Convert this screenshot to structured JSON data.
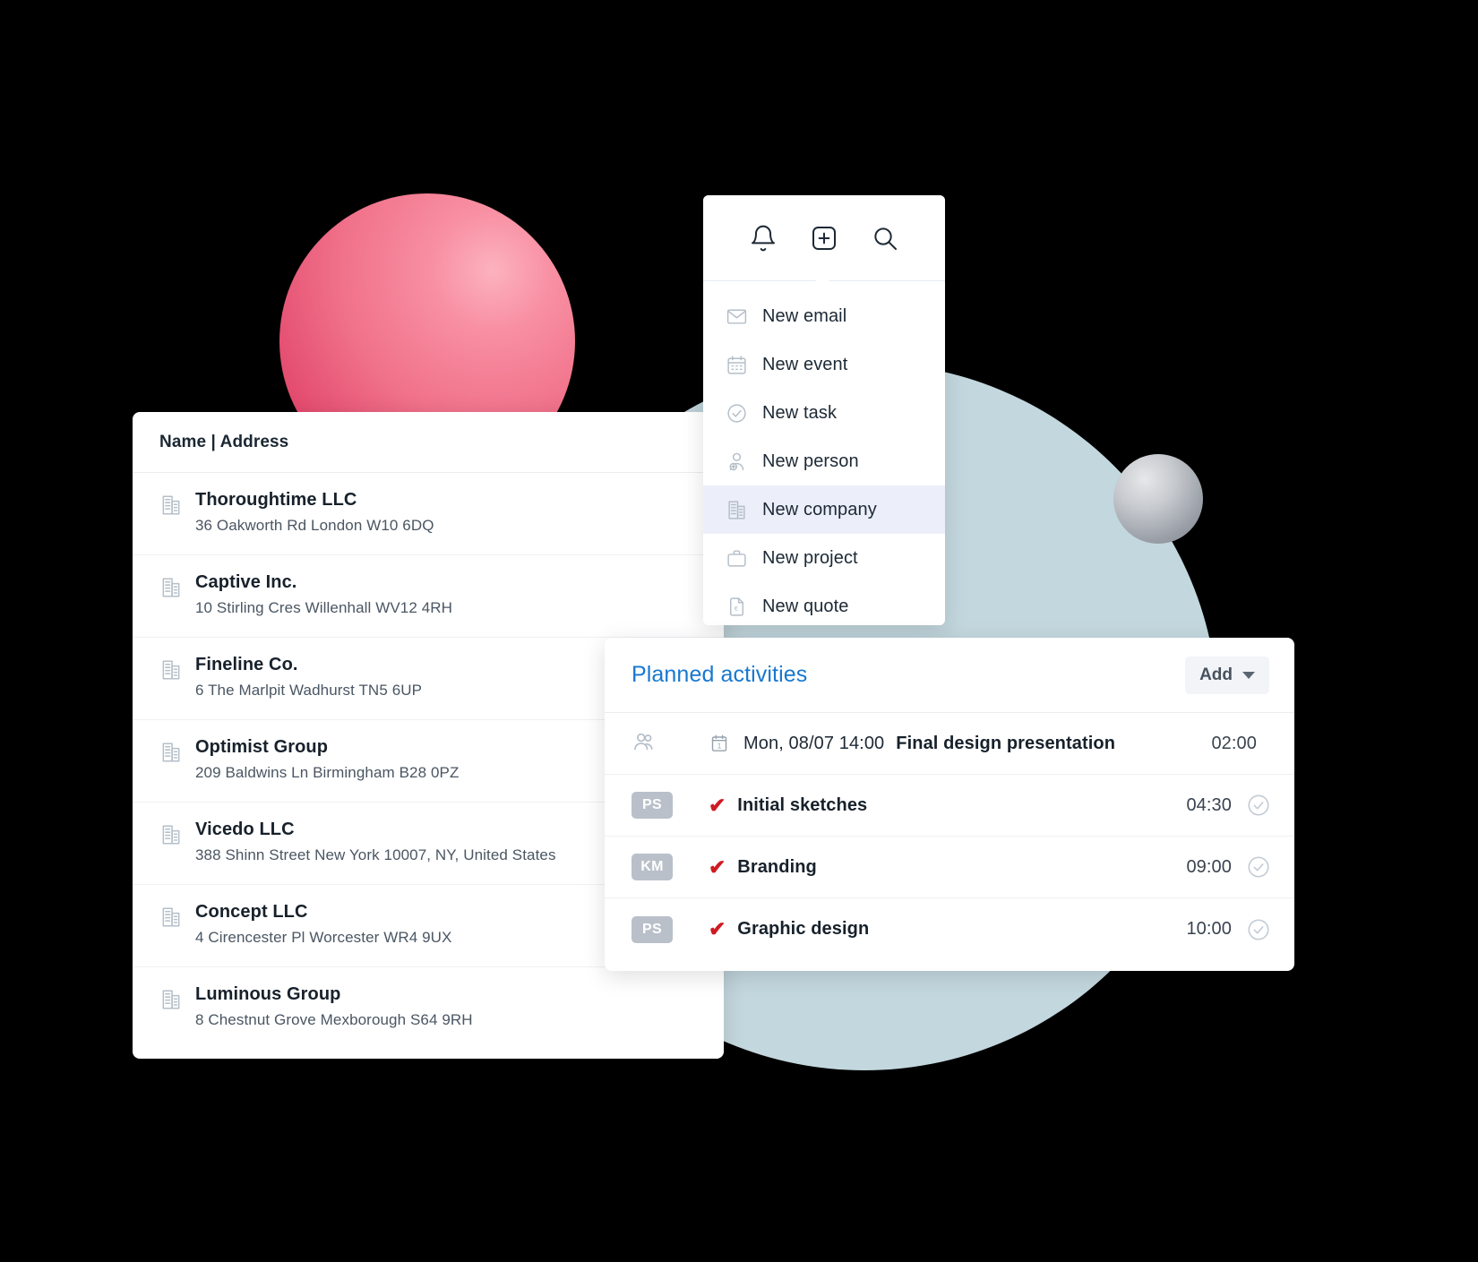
{
  "companies_card": {
    "header": "Name | Address",
    "rows": [
      {
        "icon": "building-icon",
        "name": "Thoroughtime LLC",
        "address": "36 Oakworth Rd London W10 6DQ"
      },
      {
        "icon": "building-icon",
        "name": "Captive Inc.",
        "address": "10 Stirling Cres Willenhall WV12 4RH"
      },
      {
        "icon": "building-icon",
        "name": "Fineline Co.",
        "address": "6 The Marlpit Wadhurst TN5 6UP"
      },
      {
        "icon": "building-icon",
        "name": "Optimist Group",
        "address": "209 Baldwins Ln Birmingham B28 0PZ"
      },
      {
        "icon": "building-icon",
        "name": "Vicedo LLC",
        "address": "388 Shinn Street New York 10007, NY, United States"
      },
      {
        "icon": "building-icon",
        "name": "Concept LLC",
        "address": "4 Cirencester Pl Worcester WR4 9UX"
      },
      {
        "icon": "building-icon",
        "name": "Luminous Group",
        "address": "8 Chestnut Grove Mexborough S64 9RH"
      }
    ]
  },
  "menu_card": {
    "topbar_icons": [
      "bell-icon",
      "plus-square-icon",
      "search-icon"
    ],
    "items": [
      {
        "icon": "envelope-icon",
        "label": "New email",
        "active": false
      },
      {
        "icon": "calendar-icon",
        "label": "New event",
        "active": false
      },
      {
        "icon": "check-circle-icon",
        "label": "New task",
        "active": false
      },
      {
        "icon": "person-add-icon",
        "label": "New person",
        "active": false
      },
      {
        "icon": "building-icon",
        "label": "New company",
        "active": true
      },
      {
        "icon": "briefcase-icon",
        "label": "New project",
        "active": false
      },
      {
        "icon": "document-euro-icon",
        "label": "New quote",
        "active": false
      }
    ]
  },
  "activities_card": {
    "title": "Planned activities",
    "add_label": "Add",
    "rows": [
      {
        "avatar": "",
        "avatar_icon": "people-icon",
        "has_cal": true,
        "check": false,
        "date": "Mon, 08/07 14:00",
        "name": "Final design presentation",
        "time": "02:00",
        "done_circle": false
      },
      {
        "avatar": "PS",
        "avatar_icon": "",
        "has_cal": false,
        "check": true,
        "date": "",
        "name": "Initial sketches",
        "time": "04:30",
        "done_circle": true
      },
      {
        "avatar": "KM",
        "avatar_icon": "",
        "has_cal": false,
        "check": true,
        "date": "",
        "name": "Branding",
        "time": "09:00",
        "done_circle": true
      },
      {
        "avatar": "PS",
        "avatar_icon": "",
        "has_cal": false,
        "check": true,
        "date": "",
        "name": "Graphic design",
        "time": "10:00",
        "done_circle": true
      }
    ]
  },
  "colors": {
    "background": "#000000",
    "accent_blue": "#1878d0",
    "check_red": "#cf1b23",
    "sphere_pink": "#f0718a",
    "circle_blue": "#c3d7de",
    "sphere_gray": "#9ba0a8",
    "highlight": "#eceffa",
    "avatar_gray": "#b9c0c9"
  }
}
